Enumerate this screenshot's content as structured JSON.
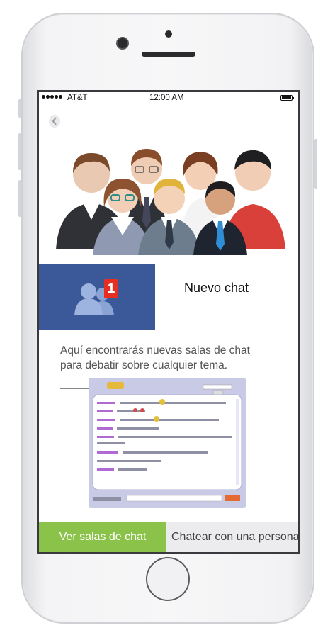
{
  "status": {
    "carrier": "AT&T",
    "time": "12:00 AM"
  },
  "main": {
    "title": "Nuevo chat",
    "badge_count": "1",
    "description": "Aquí encontrarás nuevas salas de chat para debatir sobre cualquier tema."
  },
  "buttons": {
    "primary": "Ver salas de chat",
    "secondary": "Chatear con una persona"
  },
  "colors": {
    "banner": "#3b5998",
    "primary_button": "#8bc34a",
    "badge": "#e62e22"
  },
  "icons": [
    "back-arrow-icon",
    "group-icon",
    "battery-icon",
    "signal-icon"
  ]
}
